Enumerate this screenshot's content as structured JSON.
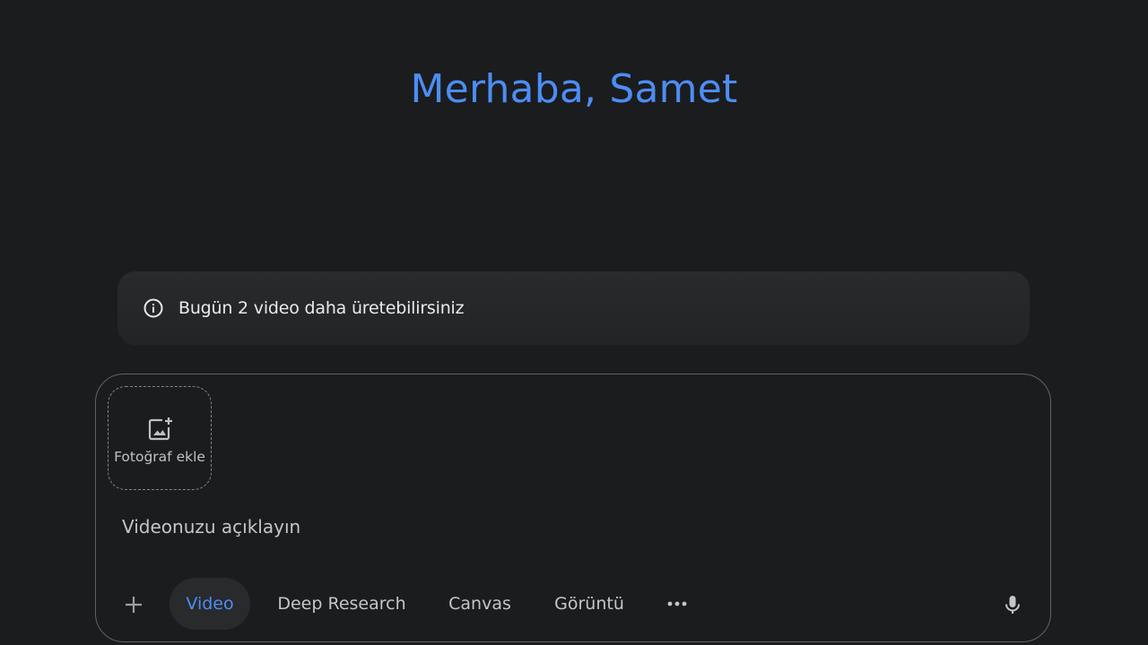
{
  "greeting": "Merhaba, Samet",
  "info_banner": {
    "icon": "info-icon",
    "text": "Bugün 2 video daha üretebilirsiniz"
  },
  "composer": {
    "photo_add": {
      "icon": "add-photo-icon",
      "label": "Fotoğraf ekle"
    },
    "input": {
      "placeholder": "Videonuzu açıklayın",
      "value": ""
    },
    "toolbar": {
      "plus_icon": "plus-icon",
      "tools": [
        {
          "label": "Video",
          "active": true
        },
        {
          "label": "Deep Research",
          "active": false
        },
        {
          "label": "Canvas",
          "active": false
        },
        {
          "label": "Görüntü",
          "active": false
        }
      ],
      "more_icon": "more-horizontal-icon",
      "mic_icon": "microphone-icon"
    }
  },
  "colors": {
    "background": "#1b1c1d",
    "accent": "#4c8df6",
    "banner": "#282a2c",
    "border": "#5f6368"
  }
}
